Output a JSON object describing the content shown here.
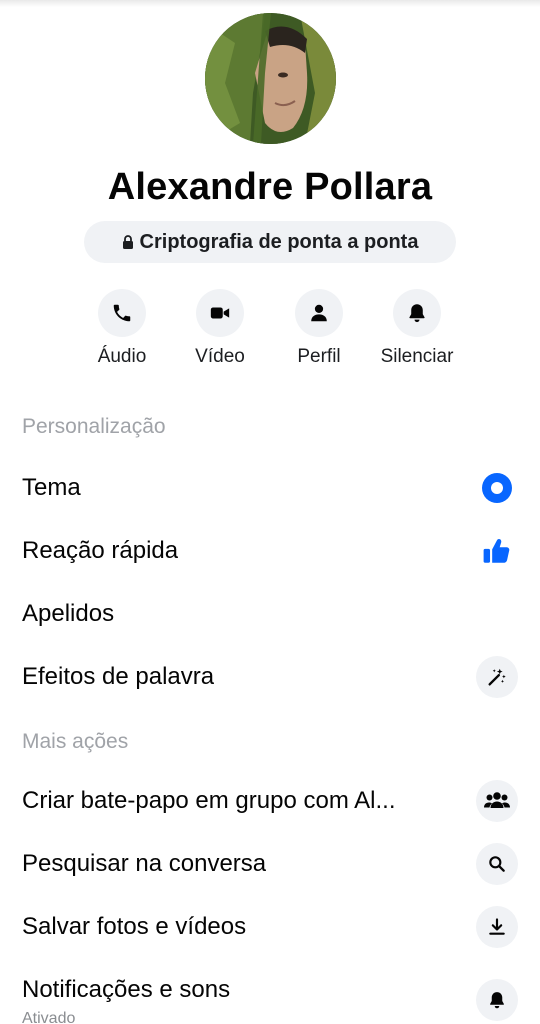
{
  "profile": {
    "name": "Alexandre Pollara",
    "encryption_label": "Criptografia de ponta a ponta"
  },
  "actions": [
    {
      "label": "Áudio",
      "icon": "phone-icon"
    },
    {
      "label": "Vídeo",
      "icon": "video-camera-icon"
    },
    {
      "label": "Perfil",
      "icon": "person-icon"
    },
    {
      "label": "Silenciar",
      "icon": "bell-icon"
    }
  ],
  "sections": {
    "personalization": {
      "title": "Personalização",
      "items": [
        {
          "label": "Tema",
          "icon": "theme-dot-icon"
        },
        {
          "label": "Reação rápida",
          "icon": "thumbs-up-icon"
        },
        {
          "label": "Apelidos"
        },
        {
          "label": "Efeitos de palavra",
          "icon": "magic-wand-icon"
        }
      ]
    },
    "more_actions": {
      "title": "Mais ações",
      "items": [
        {
          "label": "Criar bate-papo em grupo com Al...",
          "icon": "group-icon"
        },
        {
          "label": "Pesquisar na conversa",
          "icon": "search-icon"
        },
        {
          "label": "Salvar fotos e vídeos",
          "icon": "download-icon"
        },
        {
          "label": "Notificações e sons",
          "sublabel": "Ativado",
          "icon": "bell-icon"
        }
      ]
    }
  },
  "colors": {
    "accent": "#0866ff",
    "text": "#050505",
    "secondary_text": "#a0a3a8",
    "icon_bg": "#f0f2f5"
  }
}
